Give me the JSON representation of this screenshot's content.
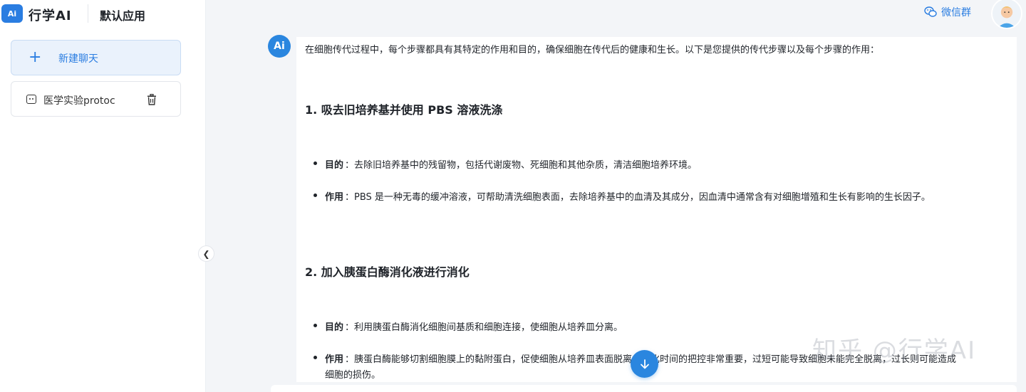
{
  "brand": {
    "logo_text": "Ai",
    "name": "行学AI",
    "app_name": "默认应用"
  },
  "sidebar": {
    "new_chat_label": "新建聊天",
    "history": [
      {
        "label": "医学实验protoc"
      }
    ]
  },
  "topbar": {
    "wechat_label": "微信群"
  },
  "message": {
    "badge": "Ai",
    "intro": "在细胞传代过程中，每个步骤都具有其特定的作用和目的，确保细胞在传代后的健康和生长。以下是您提供的传代步骤以及每个步骤的作用：",
    "sections": [
      {
        "heading": "1. 吸去旧培养基并使用 PBS 溶液洗涤",
        "items": [
          {
            "label": "目的",
            "text": "：去除旧培养基中的残留物，包括代谢废物、死细胞和其他杂质，清洁细胞培养环境。",
            "text2": ""
          },
          {
            "label": "作用",
            "text": "：PBS 是一种无毒的缓冲溶液，可帮助清洗细胞表面，去除培养基中的血清及其成分，因血清中通常含有对细胞增殖和生长有影响的生长因子。",
            "text2": ""
          }
        ]
      },
      {
        "heading": "2. 加入胰蛋白酶消化液进行消化",
        "items": [
          {
            "label": "目的",
            "text": "：利用胰蛋白酶消化细胞间基质和细胞连接，使细胞从培养皿分离。",
            "text2": ""
          },
          {
            "label": "作用",
            "text": "：胰蛋白酶能够切割细胞膜上的黏附蛋白，促使细胞从培养皿表面脱离。消化时间的把控非常重要，过短可能导致细胞未能完全脱离，过长则可能造成",
            "text2": "细胞的损伤。"
          }
        ]
      }
    ]
  },
  "watermark": "知乎 @行学AI",
  "colors": {
    "accent": "#2a7de1",
    "badge": "#2a86df",
    "background": "#f3f5f8"
  }
}
